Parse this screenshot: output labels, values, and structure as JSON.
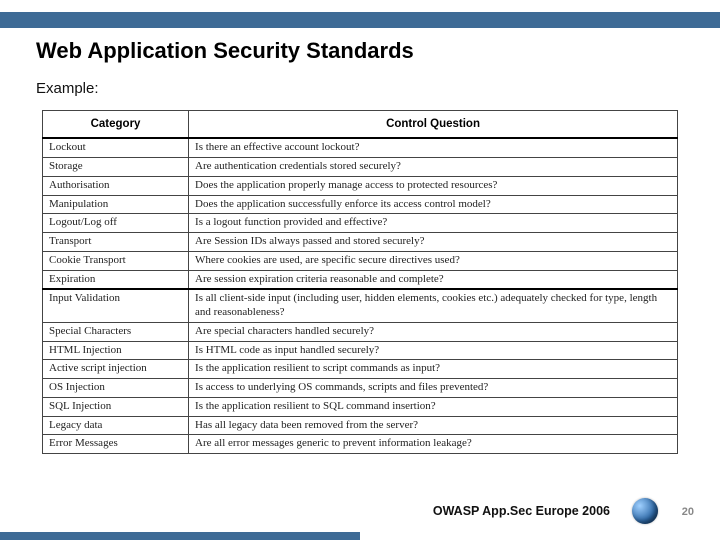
{
  "title": "Web Application Security Standards",
  "subtitle": "Example:",
  "table": {
    "headers": {
      "category": "Category",
      "question": "Control Question"
    },
    "rows": [
      {
        "category": "Lockout",
        "question": "Is there an effective account lockout?"
      },
      {
        "category": "Storage",
        "question": "Are authentication credentials stored securely?"
      },
      {
        "category": "Authorisation",
        "question": "Does the application properly manage access to protected resources?"
      },
      {
        "category": "Manipulation",
        "question": "Does the application successfully enforce its access control model?"
      },
      {
        "category": "Logout/Log off",
        "question": "Is a logout function provided and effective?"
      },
      {
        "category": "Transport",
        "question": "Are Session IDs always passed and stored securely?"
      },
      {
        "category": "Cookie Transport",
        "question": "Where cookies are used, are specific secure directives used?"
      },
      {
        "category": "Expiration",
        "question": "Are session expiration criteria reasonable and complete?"
      },
      {
        "category": "Input Validation",
        "question": "Is all client-side input (including user, hidden elements, cookies etc.) adequately checked for type, length and reasonableness?",
        "section": true
      },
      {
        "category": "Special Characters",
        "question": "Are special characters handled securely?"
      },
      {
        "category": "HTML Injection",
        "question": "Is HTML code as input handled securely?"
      },
      {
        "category": "Active script injection",
        "question": "Is the application resilient to script commands as input?"
      },
      {
        "category": "OS Injection",
        "question": "Is access to underlying OS commands, scripts and files prevented?"
      },
      {
        "category": "SQL Injection",
        "question": "Is the application resilient to SQL command insertion?"
      },
      {
        "category": "Legacy data",
        "question": "Has all legacy data been removed from the server?"
      },
      {
        "category": "Error Messages",
        "question": "Are all error messages generic to prevent information leakage?"
      }
    ]
  },
  "footer": {
    "text": "OWASP App.Sec Europe 2006",
    "page": "20"
  }
}
